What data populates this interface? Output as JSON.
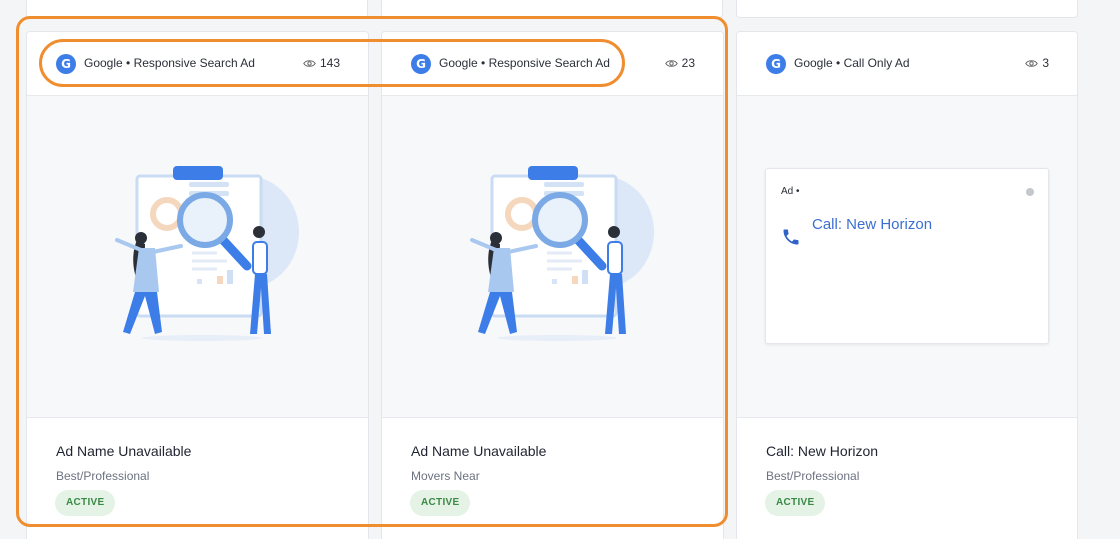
{
  "cards": [
    {
      "platform": "Google",
      "source": "Google • Responsive Search Ad",
      "views": "143",
      "ad_name": "Ad Name Unavailable",
      "ad_group": "Best/Professional",
      "status": "ACTIVE"
    },
    {
      "platform": "Google",
      "source": "Google • Responsive Search Ad",
      "views": "23",
      "ad_name": "Ad Name Unavailable",
      "ad_group": "Movers Near",
      "status": "ACTIVE"
    },
    {
      "platform": "Google",
      "source": "Google • Call Only Ad",
      "views": "3",
      "ad_name": "Call: New Horizon",
      "ad_group": "Best/Professional",
      "status": "ACTIVE",
      "preview": {
        "ad_label": "Ad •",
        "title": "Call: New Horizon"
      }
    }
  ],
  "google_logo_letter": "G",
  "icons": {
    "platform": "google-logo-icon",
    "views": "eye-icon",
    "call": "phone-icon",
    "preview": "search-report-illustration"
  },
  "colors": {
    "accent_blue": "#3d7de8",
    "link_blue": "#3c6fd1",
    "status_green": "#3a8a45",
    "status_bg": "#e5f2e6",
    "highlight": "#f08d2f"
  }
}
